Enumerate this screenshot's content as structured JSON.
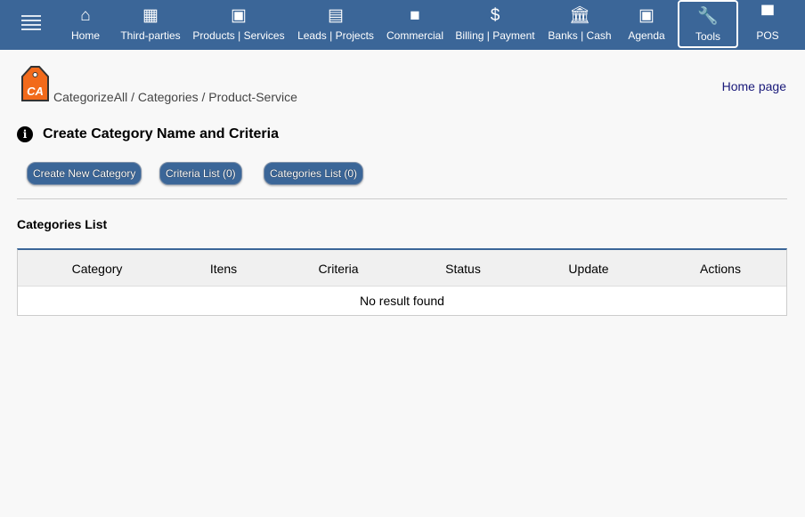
{
  "nav": {
    "items": [
      {
        "label": "Home",
        "icon": "home-icon"
      },
      {
        "label": "Third-parties",
        "icon": "building-icon"
      },
      {
        "label": "Products | Services",
        "icon": "image-icon"
      },
      {
        "label": "Leads | Projects",
        "icon": "clipboard-icon"
      },
      {
        "label": "Commercial",
        "icon": "briefcase-icon"
      },
      {
        "label": "Billing | Payment",
        "icon": "dollar-icon"
      },
      {
        "label": "Banks | Cash",
        "icon": "bank-icon"
      },
      {
        "label": "Agenda",
        "icon": "calendar-icon"
      },
      {
        "label": "Tools",
        "icon": "wrench-icon"
      },
      {
        "label": "POS",
        "icon": "store-icon"
      }
    ],
    "active": "Tools"
  },
  "logo_text": "CA",
  "breadcrumb": "CategorizeAll / Categories / Product-Service",
  "home_link": "Home page",
  "title": "Create Category Name and Criteria",
  "buttons": {
    "create": "Create New Category",
    "criteria": "Criteria List (0)",
    "categories": "Categories List (0)"
  },
  "section_title": "Categories List",
  "table": {
    "columns": [
      "Category",
      "Itens",
      "Criteria",
      "Status",
      "Update",
      "Actions"
    ],
    "empty": "No result found"
  },
  "colors": {
    "nav": "#3b6698",
    "logo": "#f26a1b"
  }
}
